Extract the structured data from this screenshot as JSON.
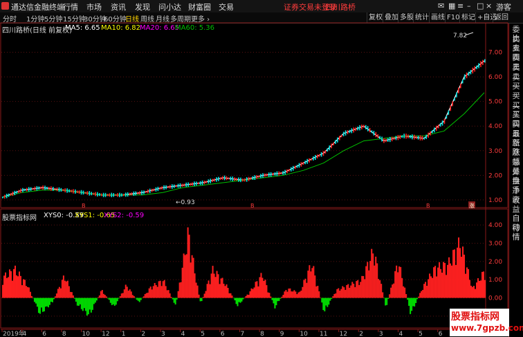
{
  "app": {
    "title": "通达信金融终端"
  },
  "menu": [
    "行情",
    "市场",
    "资讯",
    "发现",
    "问小达",
    "财富圈",
    "交易"
  ],
  "status": {
    "warning": "证券交易未登录",
    "stock_name": "四川路桥"
  },
  "window": {
    "guest": "游客"
  },
  "periods": [
    "分时",
    "1分钟",
    "5分钟",
    "15分钟",
    "30分钟",
    "60分钟",
    "日线",
    "周线",
    "月线",
    "多周期",
    "更多 ›"
  ],
  "active_period": "日线",
  "toolbar_buttons": [
    "复权",
    "叠加",
    "多股",
    "统计",
    "画线",
    "F10",
    "标记",
    "+自选",
    "返回"
  ],
  "main_header": {
    "name": "四川路桥(日线 前复权)",
    "ma5_label": "MA5: 6.65",
    "ma10_label": "MA10: 6.82",
    "ma20_label": "MA20: 6.65",
    "ma60_label": "MA60: 5.36"
  },
  "indicator_header": {
    "name": "股票指标网",
    "xys0_label": "XYS0: -0.59",
    "xys1_label": "XYS1: -0.65",
    "xys2_label": "XYS2: -0.59"
  },
  "right_panel_items": [
    "委比",
    "卖五",
    "卖四",
    "卖三",
    "卖二",
    "卖一",
    "买一",
    "买二",
    "买三",
    "买四",
    "买五",
    "最新",
    "涨跌",
    "涨幅",
    "总量",
    "外盘",
    "换手",
    "净资",
    "收益"
  ],
  "right_panel_buttons": [
    "自动",
    "行情"
  ],
  "price_axis": [
    "7.00",
    "6.00",
    "5.00",
    "4.00",
    "3.00",
    "2.00",
    "1.00"
  ],
  "indicator_axis": [
    "4.00",
    "3.00",
    "2.00",
    "1.00",
    "0.00",
    "-1.00"
  ],
  "annotations": {
    "high": "7.82",
    "low": "0.93"
  },
  "time_axis": [
    "2019年",
    "4",
    "6",
    "8",
    "10",
    "12",
    "1",
    "2",
    "3",
    "4",
    "5",
    "6",
    "7",
    "8",
    "9",
    "10",
    "11",
    "12",
    "2",
    "3",
    "4",
    "5",
    "6",
    "7",
    "8"
  ],
  "event_markers": [
    "B",
    "B",
    "B",
    "涨"
  ],
  "watermark": {
    "line1": "股票指标网",
    "line2": "www.7gpzb.com"
  },
  "colors": {
    "up": "#ff2020",
    "down": "#00e000",
    "ma5": "#ffffff",
    "ma10": "#ffff00",
    "ma20": "#ff00ff",
    "ma60": "#00c000",
    "grid_frame": "#8b1a1a"
  },
  "chart_data": [
    {
      "type": "line",
      "title": "四川路桥(日线 前复权)",
      "ylim": [
        0.8,
        8.0
      ],
      "series": [
        {
          "name": "MA5",
          "values": [
            1.1,
            1.4,
            1.5,
            1.4,
            1.3,
            1.2,
            1.2,
            1.3,
            1.5,
            1.6,
            1.7,
            1.9,
            1.8,
            2.0,
            2.1,
            2.5,
            2.9,
            3.7,
            4.0,
            3.4,
            3.6,
            3.5,
            4.2,
            6.0,
            6.65
          ]
        },
        {
          "name": "MA60",
          "values": [
            1.1,
            1.3,
            1.4,
            1.4,
            1.3,
            1.2,
            1.2,
            1.2,
            1.3,
            1.5,
            1.6,
            1.7,
            1.8,
            1.9,
            2.0,
            2.2,
            2.5,
            3.0,
            3.4,
            3.5,
            3.6,
            3.6,
            3.8,
            4.5,
            5.36
          ]
        }
      ]
    },
    {
      "type": "bar",
      "title": "股票指标网",
      "ylim": [
        -1.5,
        4.5
      ],
      "values": [
        1.3,
        1.8,
        0.8,
        -1.0,
        -0.3,
        1.4,
        -0.4,
        -1.1,
        0.5,
        -0.6,
        0.8,
        -0.3,
        0.7,
        1.1,
        -0.5,
        4.1,
        -0.4,
        1.8,
        0.9,
        -0.5,
        0.4,
        1.5,
        -0.6,
        0.6,
        0.3,
        2.2,
        -0.9,
        0.5,
        0.8,
        1.1,
        3.0,
        -0.6,
        2.3,
        -1.0,
        0.7,
        1.9,
        2.1,
        3.5,
        0.6,
        1.7
      ]
    }
  ]
}
